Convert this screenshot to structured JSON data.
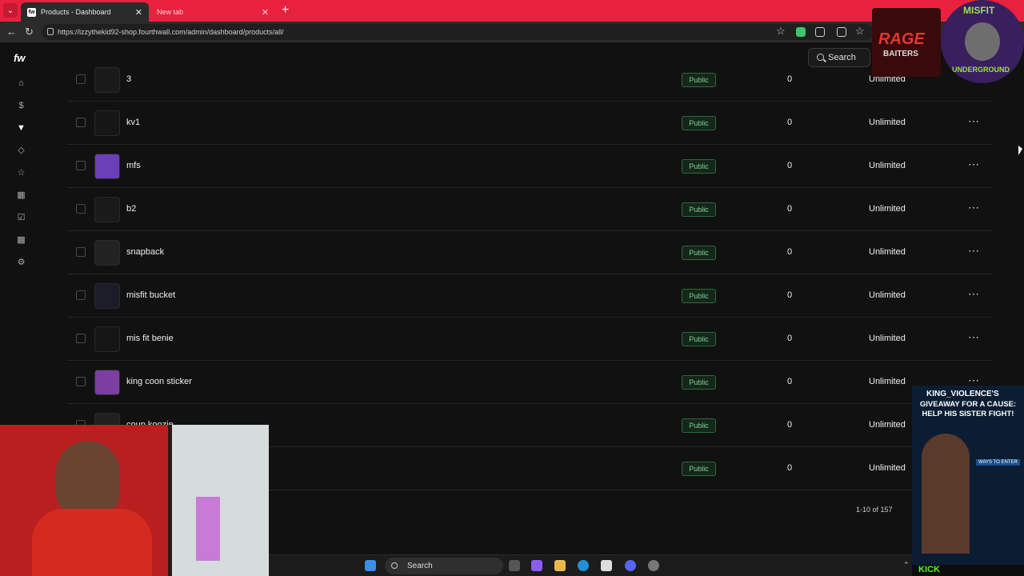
{
  "browser": {
    "tabs": [
      {
        "title": "Products - Dashboard",
        "favicon": "fw"
      },
      {
        "title": "New tab"
      }
    ],
    "url": "https://izzythekid92-shop.fourthwall.com/admin/dashboard/products/all/"
  },
  "app": {
    "logo": "fw",
    "search_label": "Search",
    "sidebar_icons": [
      "home-icon",
      "dollar-icon",
      "shirt-icon",
      "tag-icon",
      "star-icon",
      "layout-icon",
      "checklist-icon",
      "apps-icon",
      "settings-icon"
    ]
  },
  "products": {
    "rows": [
      {
        "name": "3",
        "status": "Public",
        "sold": "0",
        "inventory": "Unlimited"
      },
      {
        "name": "kv1",
        "status": "Public",
        "sold": "0",
        "inventory": "Unlimited"
      },
      {
        "name": "mfs",
        "status": "Public",
        "sold": "0",
        "inventory": "Unlimited"
      },
      {
        "name": "b2",
        "status": "Public",
        "sold": "0",
        "inventory": "Unlimited"
      },
      {
        "name": "snapback",
        "status": "Public",
        "sold": "0",
        "inventory": "Unlimited"
      },
      {
        "name": "misfit bucket",
        "status": "Public",
        "sold": "0",
        "inventory": "Unlimited"
      },
      {
        "name": "mis fit benie",
        "status": "Public",
        "sold": "0",
        "inventory": "Unlimited"
      },
      {
        "name": "king coon sticker",
        "status": "Public",
        "sold": "0",
        "inventory": "Unlimited"
      },
      {
        "name": "coup koozie",
        "status": "Public",
        "sold": "0",
        "inventory": "Unlimited"
      },
      {
        "name": "",
        "status": "Public",
        "sold": "0",
        "inventory": "Unlimited"
      }
    ],
    "pagination": "1-10 of 157"
  },
  "taskbar": {
    "search_label": "Search"
  },
  "overlays": {
    "rage_logo_lines": [
      "RAGE",
      "BAITERS"
    ],
    "misfit_logo_lines": [
      "MISFIT",
      "UNDERGROUND"
    ],
    "ad": {
      "handle": "KING_VIOLENCE'S",
      "headline": "GIVEAWAY FOR A CAUSE: HELP HIS SISTER FIGHT!",
      "ways": "WAYS TO ENTER",
      "footer": "KICK"
    }
  },
  "colors": {
    "tabbar": "#e8213f",
    "badge_text": "#7dd495",
    "badge_border": "#2e6a3c"
  }
}
